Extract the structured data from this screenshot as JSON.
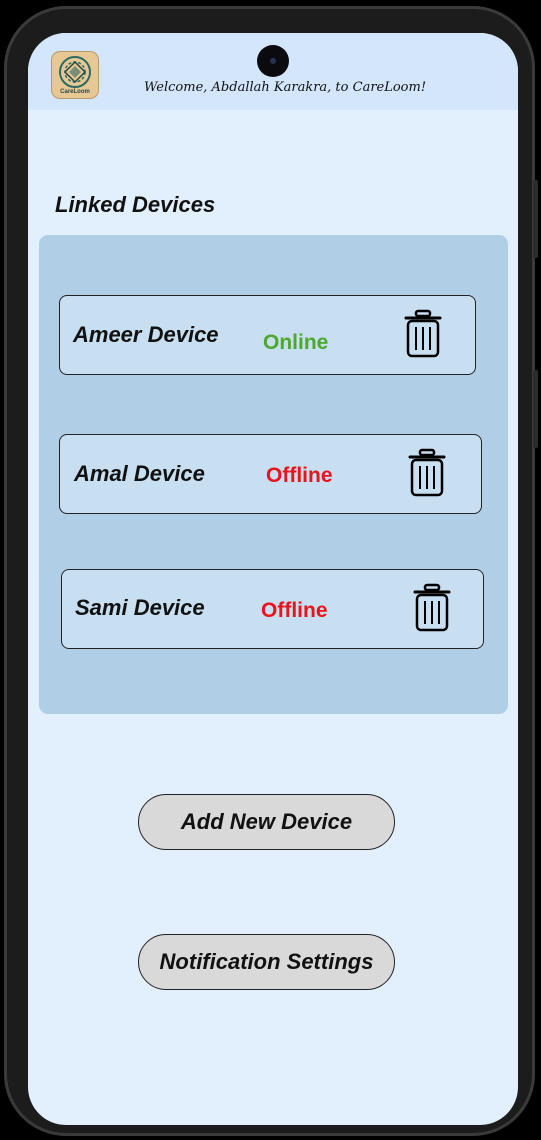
{
  "header": {
    "logo_text": "CareLoom",
    "welcome_text": "Welcome, Abdallah Karakra, to CareLoom!"
  },
  "linked_devices": {
    "title": "Linked Devices",
    "devices": [
      {
        "name": "Ameer Device",
        "status": "Online",
        "status_color": "#4ea72e",
        "delete_icon": "trash-icon"
      },
      {
        "name": "Amal Device",
        "status": "Offline",
        "status_color": "#e8141b",
        "delete_icon": "trash-icon"
      },
      {
        "name": "Sami Device",
        "status": "Offline",
        "status_color": "#e8141b",
        "delete_icon": "trash-icon"
      }
    ]
  },
  "actions": {
    "add_device_label": "Add New Device",
    "notification_settings_label": "Notification Settings"
  },
  "colors": {
    "screen_background": "#e2effc",
    "header_background": "#d3e6fb",
    "panel_background": "#b0cfe6",
    "card_background": "#c7dff0",
    "button_background": "#d9d9d9",
    "online": "#4ea72e",
    "offline": "#e8141b"
  }
}
